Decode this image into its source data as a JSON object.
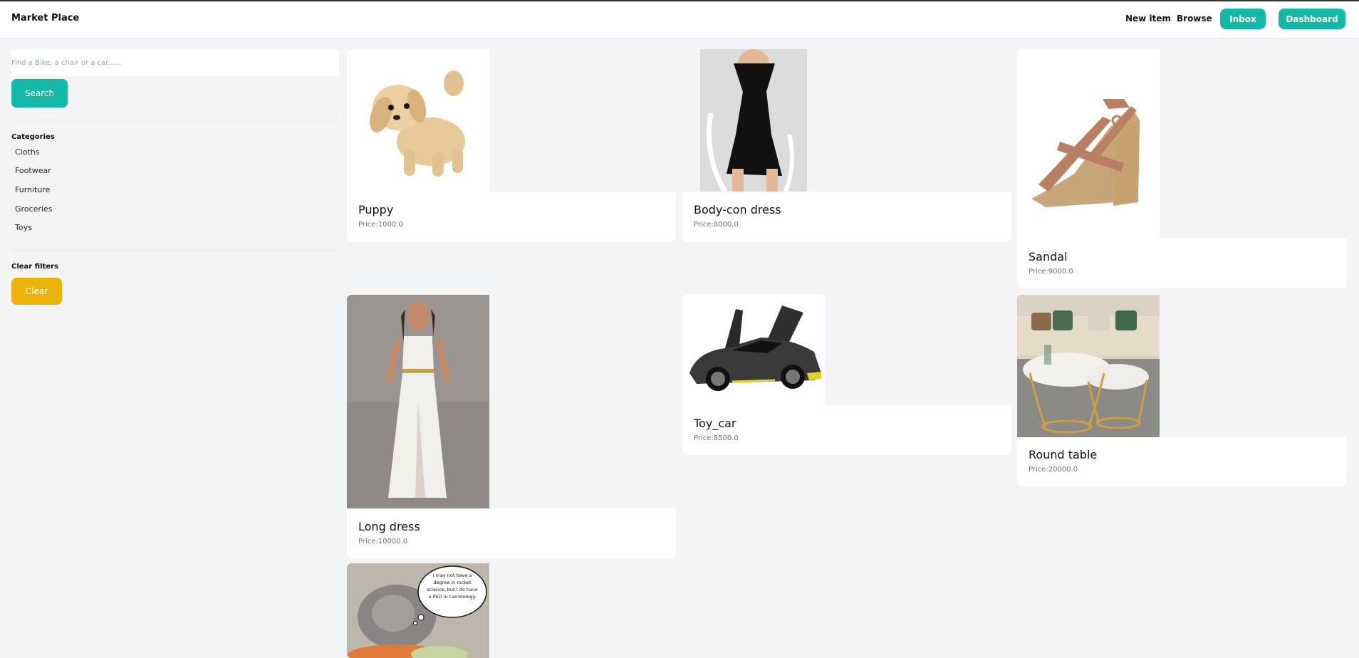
{
  "navbar": {
    "brand": "Market Place",
    "new_item": "New item",
    "browse": "Browse",
    "inbox": "Inbox",
    "dashboard": "Dashboard"
  },
  "sidebar": {
    "search_placeholder": "Find a Bike, a chair or a car......",
    "search_button": "Search",
    "categories_title": "Categories",
    "categories": [
      "Cloths",
      "Footwear",
      "Furniture",
      "Groceries",
      "Toys"
    ],
    "clear_title": "Clear filters",
    "clear_button": "Clear"
  },
  "items": [
    {
      "name": "Puppy",
      "price": "Price:1000.0",
      "image": "plush-puppy-image"
    },
    {
      "name": "Body-con dress",
      "price": "Price:8000.0",
      "image": "black-dress-image"
    },
    {
      "name": "Sandal",
      "price": "Price:9000.0",
      "image": "wedge-sandal-image"
    },
    {
      "name": "Long dress",
      "price": "Price:10000.0",
      "image": "white-gown-image"
    },
    {
      "name": "Toy_car",
      "price": "Price:8500.0",
      "image": "sports-car-image"
    },
    {
      "name": "Round table",
      "price": "Price:20000.0",
      "image": "round-table-image"
    },
    {
      "name": "",
      "price": "",
      "image": "rabbit-meme-image",
      "image_caption": "I may not have a degree in rocket science, but I do have a PhD in carrotology."
    }
  ],
  "colors": {
    "teal": "#14b8a6",
    "yellow": "#eab308",
    "background": "#f3f4f6"
  }
}
